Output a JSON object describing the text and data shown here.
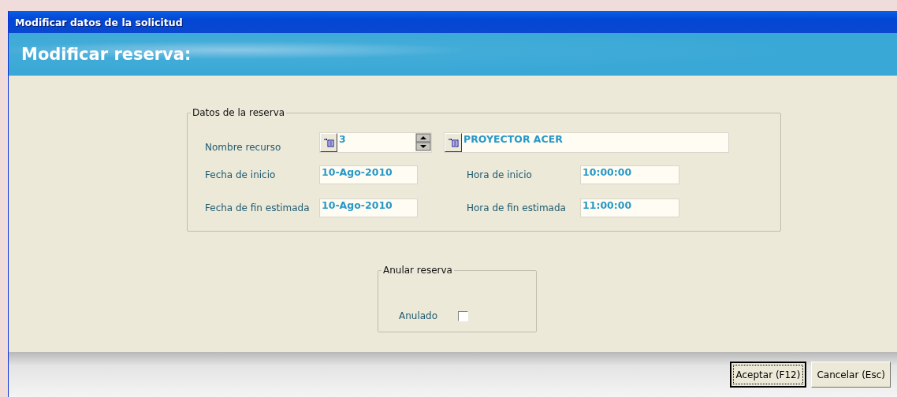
{
  "window": {
    "title": "Modificar datos de la solicitud"
  },
  "header": {
    "title": "Modificar reserva:"
  },
  "reservation_group": {
    "legend": "Datos de la reserva",
    "resource": {
      "label": "Nombre recurso",
      "code": "3",
      "name": "PROYECTOR ACER"
    },
    "fields": [
      {
        "label": "Fecha de inicio",
        "value": "10-Ago-2010"
      },
      {
        "label": "Hora de inicio",
        "value": "10:00:00"
      },
      {
        "label": "Fecha de fin estimada",
        "value": "10-Ago-2010"
      },
      {
        "label": "Hora de fin estimada",
        "value": "11:00:00"
      }
    ]
  },
  "cancel_group": {
    "legend": "Anular reserva",
    "checkbox": {
      "label": "Anulado",
      "checked": false
    }
  },
  "buttons": [
    {
      "label": "Aceptar (F12)",
      "default": true
    },
    {
      "label": "Cancelar (Esc)",
      "default": false
    }
  ]
}
